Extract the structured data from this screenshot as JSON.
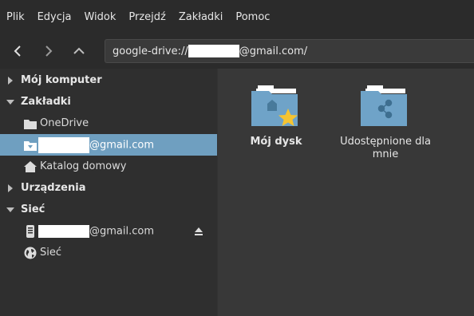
{
  "menu": [
    "Plik",
    "Edycja",
    "Widok",
    "Przejdź",
    "Zakładki",
    "Pomoc"
  ],
  "address": {
    "prefix": "google-drive://",
    "suffix": "@gmail.com/"
  },
  "sidebar": {
    "sections": [
      {
        "title": "Mój komputer",
        "expanded": false
      },
      {
        "title": "Zakładki",
        "expanded": true
      },
      {
        "title": "Urządzenia",
        "expanded": false
      },
      {
        "title": "Sieć",
        "expanded": true
      }
    ],
    "bookmarks": [
      {
        "label": "OneDrive",
        "icon": "folder-icon"
      },
      {
        "label": "@gmail.com",
        "icon": "folder-download-icon",
        "selected": true
      },
      {
        "label": "Katalog domowy",
        "icon": "home-icon"
      }
    ],
    "network": [
      {
        "label": "@gmail.com",
        "icon": "drive-icon"
      },
      {
        "label": "Sieć",
        "icon": "network-globe-icon"
      }
    ]
  },
  "files": [
    {
      "name": "Mój dysk",
      "icon": "my-drive-folder-icon"
    },
    {
      "name": "Udostępnione dla mnie",
      "icon": "shared-folder-icon"
    }
  ],
  "colors": {
    "accent": "#6f9fc0",
    "folder": "#6fa3c8",
    "star": "#f5c431"
  }
}
